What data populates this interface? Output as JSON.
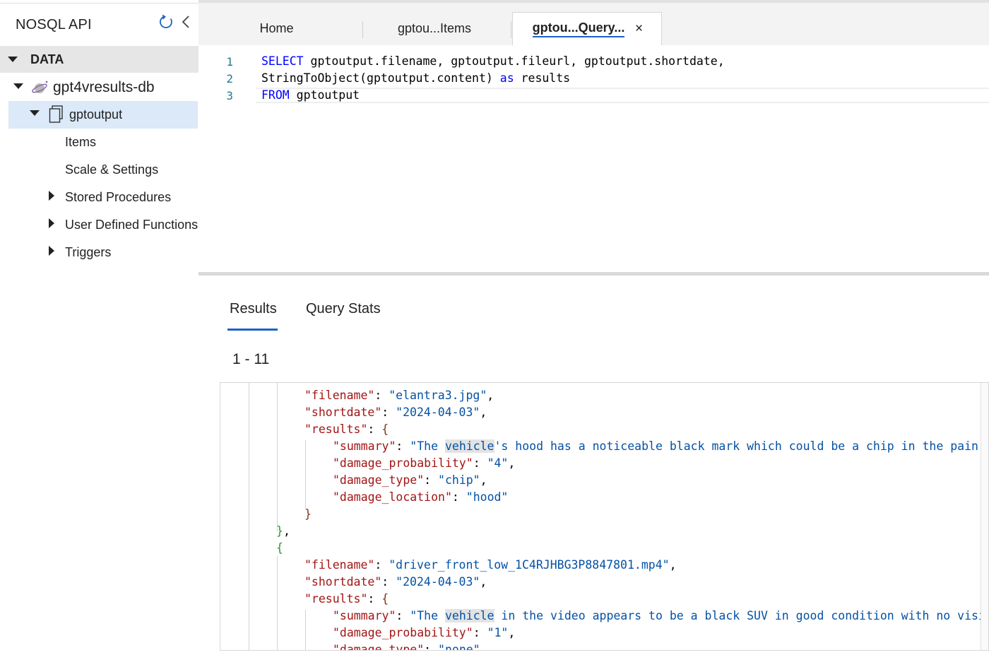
{
  "sidebar": {
    "title": "NOSQL API",
    "section": "DATA",
    "database": "gpt4vresults-db",
    "container": "gptoutput",
    "children": [
      "Items",
      "Scale & Settings",
      "Stored Procedures",
      "User Defined Functions",
      "Triggers"
    ]
  },
  "tabs": [
    {
      "label": "Home"
    },
    {
      "label": "gptou...Items"
    },
    {
      "label": "gptou...Query...",
      "close": "×"
    }
  ],
  "editor": {
    "line_numbers": [
      "1",
      "2",
      "3"
    ],
    "lines": [
      {
        "kw": "SELECT",
        "rest": " gptoutput.filename, gptoutput.fileurl, gptoutput.shortdate,"
      },
      {
        "pre": "StringToObject(gptoutput.content) ",
        "kw": "as",
        "rest": " results"
      },
      {
        "kw": "FROM",
        "rest": " gptoutput"
      }
    ]
  },
  "results": {
    "tabs": [
      "Results",
      "Query Stats"
    ],
    "count": "1 - 11",
    "json": {
      "f1_key": "\"filename\"",
      "f1_val": "\"elantra3.jpg\"",
      "d1_key": "\"shortdate\"",
      "d1_val": "\"2024-04-03\"",
      "r1_key": "\"results\"",
      "s1_key": "\"summary\"",
      "s1_pre": "\"The ",
      "s1_hl": "vehicle",
      "s1_post": "'s hood has a noticeable black mark which could be a chip in the pain",
      "p1_key": "\"damage_probability\"",
      "p1_val": "\"4\"",
      "t1_key": "\"damage_type\"",
      "t1_val": "\"chip\"",
      "l1_key": "\"damage_location\"",
      "l1_val": "\"hood\"",
      "f2_key": "\"filename\"",
      "f2_val": "\"driver_front_low_1C4RJHBG3P8847801.mp4\"",
      "d2_key": "\"shortdate\"",
      "d2_val": "\"2024-04-03\"",
      "r2_key": "\"results\"",
      "s2_key": "\"summary\"",
      "s2_pre": "\"The ",
      "s2_hl": "vehicle",
      "s2_post": " in the video appears to be a black SUV in good condition with no visi",
      "p2_key": "\"damage_probability\"",
      "p2_val": "\"1\"",
      "t2_key": "\"damage_type\"",
      "t2_val": "\"none\""
    }
  }
}
